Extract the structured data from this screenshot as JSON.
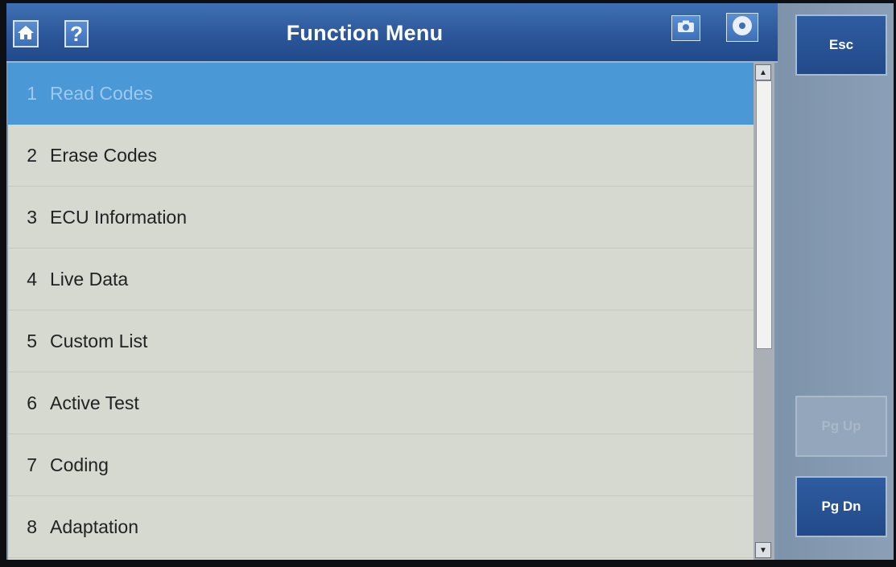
{
  "header": {
    "title": "Function Menu",
    "home_icon": "home-icon",
    "help_label": "?",
    "camera_icon": "camera-icon",
    "disc_icon": "disc-icon"
  },
  "menu": {
    "selected_index": 0,
    "items": [
      {
        "num": "1",
        "label": "Read Codes"
      },
      {
        "num": "2",
        "label": "Erase Codes"
      },
      {
        "num": "3",
        "label": "ECU Information"
      },
      {
        "num": "4",
        "label": "Live Data"
      },
      {
        "num": "5",
        "label": "Custom List"
      },
      {
        "num": "6",
        "label": "Active Test"
      },
      {
        "num": "7",
        "label": "Coding"
      },
      {
        "num": "8",
        "label": "Adaptation"
      }
    ]
  },
  "side": {
    "esc_label": "Esc",
    "pgup_label": "Pg Up",
    "pgdn_label": "Pg Dn"
  },
  "colors": {
    "titlebar": "#2a5598",
    "selected_row": "#4a99d6",
    "list_bg": "#d5d9d0",
    "side_bg": "#8196ad"
  }
}
